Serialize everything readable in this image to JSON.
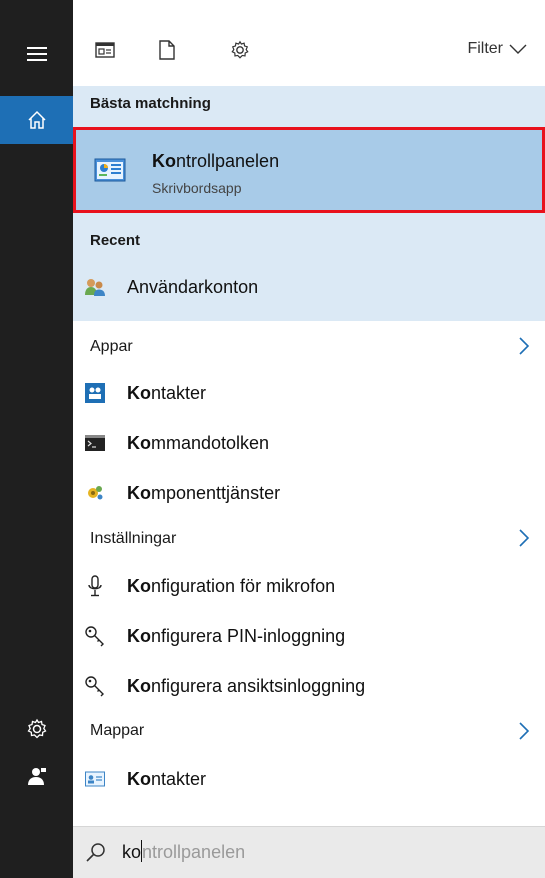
{
  "toolbar": {
    "filter_label": "Filter"
  },
  "best_match": {
    "title": "Bästa matchning",
    "item": {
      "bold": "Ko",
      "rest": "ntrollpanelen",
      "subtitle": "Skrivbordsapp",
      "icon": "control-panel-icon"
    }
  },
  "recent": {
    "title": "Recent",
    "items": [
      {
        "label": "Användarkonton",
        "icon": "user-accounts-icon"
      }
    ]
  },
  "apps": {
    "title": "Appar",
    "items": [
      {
        "bold": "Ko",
        "rest": "ntakter",
        "icon": "contacts-app-icon"
      },
      {
        "bold": "Ko",
        "rest": "mmandotolken",
        "icon": "command-prompt-icon"
      },
      {
        "bold": "Ko",
        "rest": "mponenttjänster",
        "icon": "component-services-icon"
      }
    ]
  },
  "settings": {
    "title": "Inställningar",
    "items": [
      {
        "bold": "Ko",
        "rest": "nfiguration för mikrofon",
        "icon": "microphone-icon"
      },
      {
        "bold": "Ko",
        "rest": "nfigurera PIN-inloggning",
        "icon": "key-icon"
      },
      {
        "bold": "Ko",
        "rest": "nfigurera ansiktsinloggning",
        "icon": "key-icon"
      }
    ]
  },
  "folders": {
    "title": "Mappar",
    "items": [
      {
        "bold": "Ko",
        "rest": "ntakter",
        "icon": "contact-card-icon"
      }
    ]
  },
  "search": {
    "typed": "ko",
    "suggestion": "ntrollpanelen"
  },
  "colors": {
    "sidebar": "#1f1f1f",
    "accent": "#1e6fb5",
    "selected": "#a8cbe8",
    "highlight_border": "#e8111c"
  }
}
